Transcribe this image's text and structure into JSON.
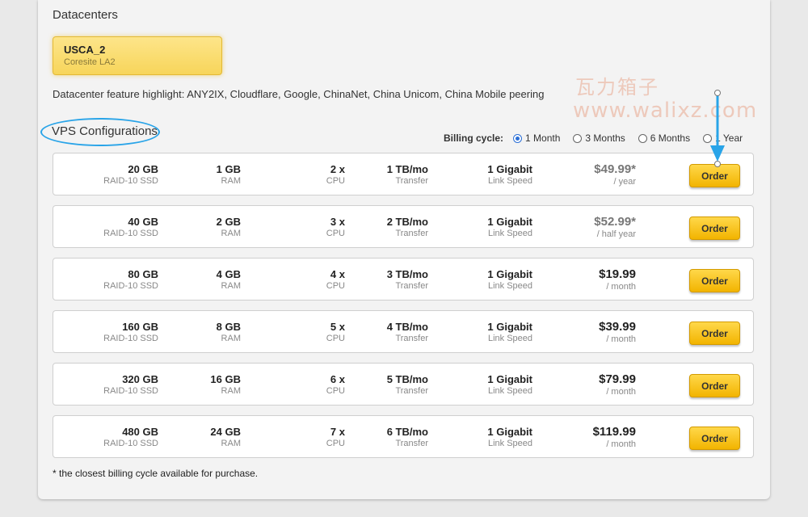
{
  "datacenters": {
    "title": "Datacenters",
    "selected": {
      "name": "USCA_2",
      "subtitle": "Coresite LA2"
    },
    "feature_highlight": "Datacenter feature highlight: ANY2IX, Cloudflare, Google, ChinaNet, China Unicom, China Mobile peering"
  },
  "watermark": {
    "line1": "瓦力箱子",
    "line2": "www.walixz.com"
  },
  "vps": {
    "title": "VPS Configurations"
  },
  "billing": {
    "label": "Billing cycle:",
    "options": [
      "1 Month",
      "3 Months",
      "6 Months",
      "1 Year"
    ],
    "selected": "1 Month"
  },
  "plans": [
    {
      "disk": "20 GB",
      "disk_sub": "RAID-10 SSD",
      "ram": "1 GB",
      "ram_sub": "RAM",
      "cpu": "2 x",
      "cpu_sub": "CPU",
      "bw": "1 TB/mo",
      "bw_sub": "Transfer",
      "link": "1 Gigabit",
      "link_sub": "Link Speed",
      "price": "$49.99*",
      "period": "/ year",
      "order": "Order"
    },
    {
      "disk": "40 GB",
      "disk_sub": "RAID-10 SSD",
      "ram": "2 GB",
      "ram_sub": "RAM",
      "cpu": "3 x",
      "cpu_sub": "CPU",
      "bw": "2 TB/mo",
      "bw_sub": "Transfer",
      "link": "1 Gigabit",
      "link_sub": "Link Speed",
      "price": "$52.99*",
      "period": "/ half year",
      "order": "Order"
    },
    {
      "disk": "80 GB",
      "disk_sub": "RAID-10 SSD",
      "ram": "4 GB",
      "ram_sub": "RAM",
      "cpu": "4 x",
      "cpu_sub": "CPU",
      "bw": "3 TB/mo",
      "bw_sub": "Transfer",
      "link": "1 Gigabit",
      "link_sub": "Link Speed",
      "price": "$19.99",
      "period": "/ month",
      "order": "Order"
    },
    {
      "disk": "160 GB",
      "disk_sub": "RAID-10 SSD",
      "ram": "8 GB",
      "ram_sub": "RAM",
      "cpu": "5 x",
      "cpu_sub": "CPU",
      "bw": "4 TB/mo",
      "bw_sub": "Transfer",
      "link": "1 Gigabit",
      "link_sub": "Link Speed",
      "price": "$39.99",
      "period": "/ month",
      "order": "Order"
    },
    {
      "disk": "320 GB",
      "disk_sub": "RAID-10 SSD",
      "ram": "16 GB",
      "ram_sub": "RAM",
      "cpu": "6 x",
      "cpu_sub": "CPU",
      "bw": "5 TB/mo",
      "bw_sub": "Transfer",
      "link": "1 Gigabit",
      "link_sub": "Link Speed",
      "price": "$79.99",
      "period": "/ month",
      "order": "Order"
    },
    {
      "disk": "480 GB",
      "disk_sub": "RAID-10 SSD",
      "ram": "24 GB",
      "ram_sub": "RAM",
      "cpu": "7 x",
      "cpu_sub": "CPU",
      "bw": "6 TB/mo",
      "bw_sub": "Transfer",
      "link": "1 Gigabit",
      "link_sub": "Link Speed",
      "price": "$119.99",
      "period": "/ month",
      "order": "Order"
    }
  ],
  "footnote": "* the closest billing cycle available for purchase.",
  "colors": {
    "accent_circle": "#29a4e8",
    "order_button": "#f2b400",
    "selected_card": "#f7d55a"
  }
}
